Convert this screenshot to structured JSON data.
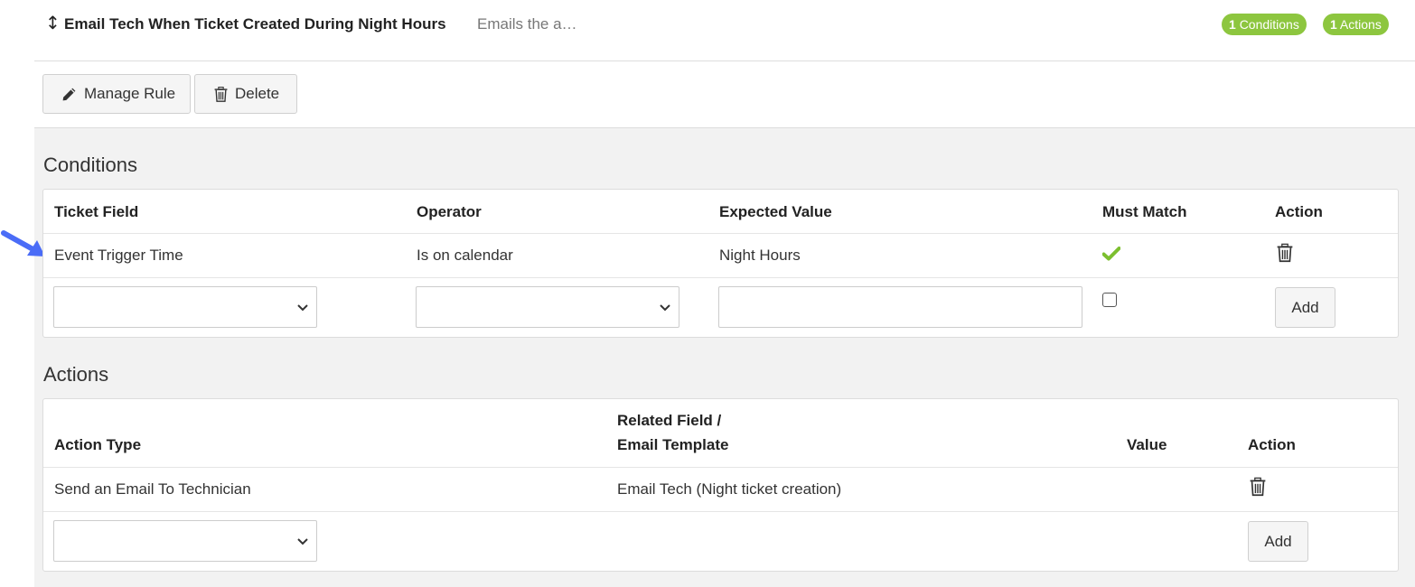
{
  "rule": {
    "title": "Email Tech When Ticket Created During Night Hours",
    "description": "Emails the a…",
    "conditions_badge": {
      "count": "1",
      "label": "Conditions"
    },
    "actions_badge": {
      "count": "1",
      "label": "Actions"
    }
  },
  "toolbar": {
    "manage_label": "Manage Rule",
    "delete_label": "Delete"
  },
  "conditions": {
    "title": "Conditions",
    "headers": {
      "ticket_field": "Ticket Field",
      "operator": "Operator",
      "expected_value": "Expected Value",
      "must_match": "Must Match",
      "action": "Action"
    },
    "rows": [
      {
        "ticket_field": "Event Trigger Time",
        "operator": "Is on calendar",
        "expected_value": "Night Hours",
        "must_match": true
      }
    ],
    "new_row": {
      "ticket_field": "",
      "operator": "",
      "expected_value": "",
      "must_match": false,
      "add_label": "Add"
    }
  },
  "actions": {
    "title": "Actions",
    "headers": {
      "action_type": "Action Type",
      "related_line1": "Related Field /",
      "related_line2": "Email Template",
      "value": "Value",
      "action": "Action"
    },
    "rows": [
      {
        "action_type": "Send an Email To Technician",
        "related": "Email Tech (Night ticket creation)",
        "value": ""
      }
    ],
    "new_row": {
      "action_type": "",
      "add_label": "Add"
    }
  },
  "colors": {
    "accent_green": "#8dc63f",
    "annotation_arrow": "#4a6cf7"
  },
  "icons": [
    "sort-arrows-icon",
    "pencil-icon",
    "trash-icon",
    "checkmark-icon",
    "chevron-down-icon",
    "annotation-arrow-icon"
  ]
}
